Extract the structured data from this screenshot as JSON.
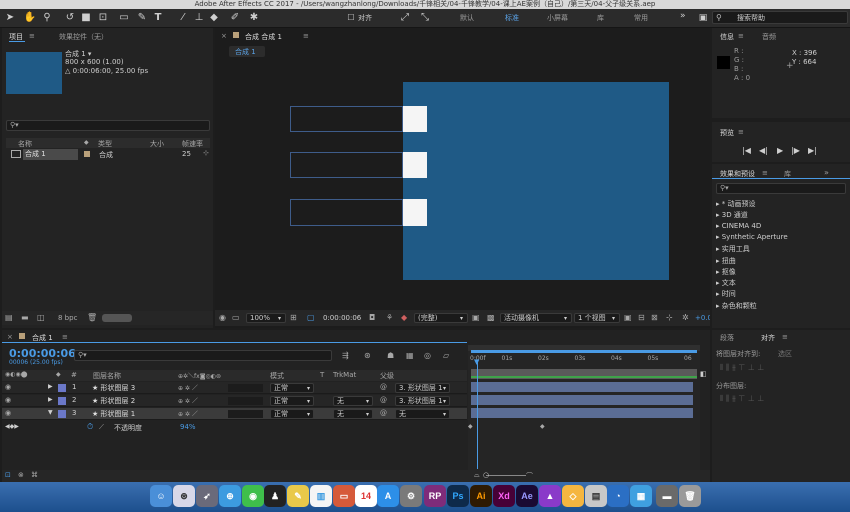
{
  "app": {
    "title": "Adobe After Effects CC 2017 - /Users/wangzhanlong/Downloads/千锋相关/04-千锋教学/04-课上AE案例（自己）/第三天/04-父子级关系.aep"
  },
  "workspaces": {
    "w1": "默认",
    "w2": "标准",
    "w3": "小屏幕",
    "w4": "库",
    "w5": "常用",
    "more": "»"
  },
  "toolbar": {
    "align_label": "对齐"
  },
  "search_help": {
    "placeholder": "搜索帮助"
  },
  "project": {
    "tab_project": "项目",
    "tab_effects": "效果控件（无）",
    "comp_name": "合成 1 ▾",
    "comp_size": "800 x 600 (1.00)",
    "comp_duration": "△ 0:00:06:00, 25.00 fps",
    "col_name": "名称",
    "col_type": "类型",
    "col_size": "大小",
    "col_fps": "帧速率",
    "item_name": "合成 1",
    "item_type": "合成",
    "item_fps": "25",
    "bpc": "8 bpc"
  },
  "viewer": {
    "tab": "合成 合成 1",
    "subtab": "合成 1",
    "zoom": "100%",
    "time": "0:00:00:06",
    "quality": "(完整)",
    "camera": "活动摄像机",
    "views": "1 个视图",
    "offset": "+0.0"
  },
  "info": {
    "tab_info": "信息",
    "tab_audio": "音频",
    "r": "R :",
    "g": "G :",
    "b": "B :",
    "a": "A : 0",
    "x": "X : 396",
    "y": "Y : 664"
  },
  "preview": {
    "title": "预览"
  },
  "effects": {
    "title": "效果和预设",
    "lib": "库",
    "items": [
      "▸ * 动画预设",
      "▸ 3D 通道",
      "▸ CINEMA 4D",
      "▸ Synthetic Aperture",
      "▸ 实用工具",
      "▸ 扭曲",
      "▸ 抠像",
      "▸ 文本",
      "▸ 时间",
      "▸ 杂色和颗粒"
    ]
  },
  "align": {
    "tab_para": "段落",
    "tab_align": "对齐",
    "align_to": "将图层对齐到:",
    "selection": "选区",
    "distribute": "分布图层:"
  },
  "timeline": {
    "tab": "合成 1",
    "timecode": "0:00:00:06",
    "frames": "00006 (25.00 fps)",
    "col_num": "#",
    "col_source": "图层名称",
    "col_mode": "模式",
    "col_t": "T",
    "col_trkmat": "TrkMat",
    "col_parent": "父级",
    "layers": [
      {
        "num": "1",
        "name": "★ 形状图层 3",
        "mode": "正常",
        "trkmat": "",
        "parent": "3. 形状图层 1"
      },
      {
        "num": "2",
        "name": "★ 形状图层 2",
        "mode": "正常",
        "trkmat": "无",
        "parent": "3. 形状图层 1"
      },
      {
        "num": "3",
        "name": "★ 形状图层 1",
        "mode": "正常",
        "trkmat": "无",
        "parent": "无"
      }
    ],
    "opacity_label": "不透明度",
    "opacity_value": "94%",
    "ruler": [
      "0:00f",
      "01s",
      "02s",
      "03s",
      "04s",
      "05s",
      "06"
    ]
  },
  "colors": {
    "accent": "#4a9be5",
    "canvas": "#1f5a86",
    "layer_bar": "#5b6d95",
    "label": "#6b78c8"
  }
}
